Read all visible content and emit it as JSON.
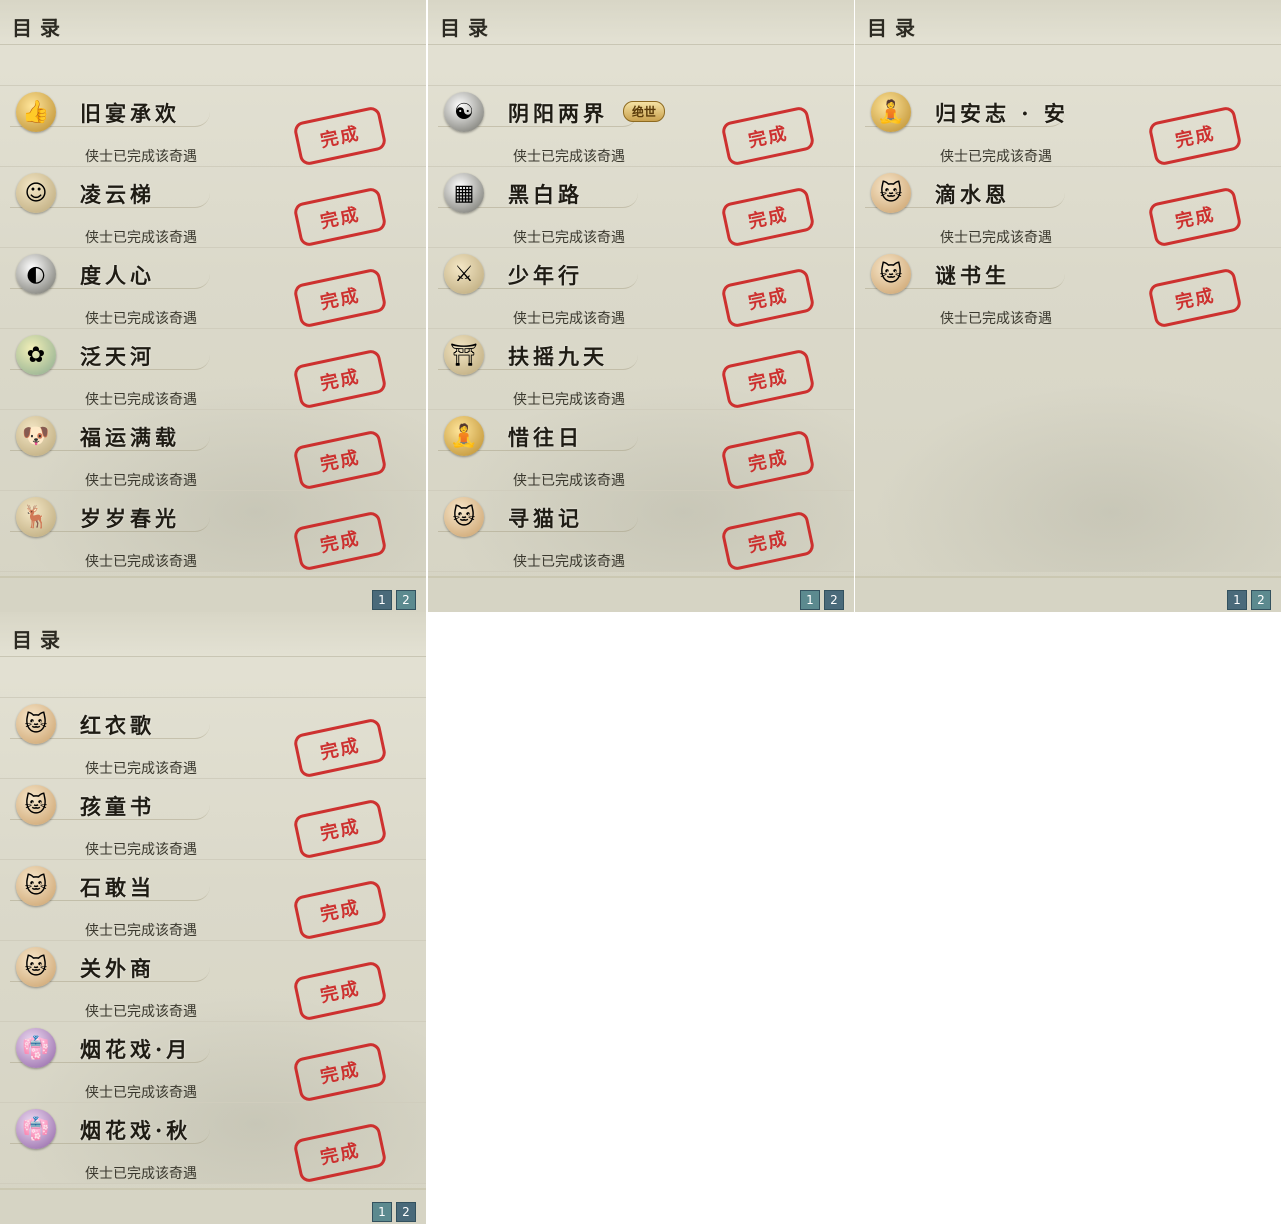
{
  "panels": [
    {
      "title": "目录",
      "rows": [
        {
          "name": "旧宴承欢",
          "icon": "thumb-icon",
          "glyph": "👍",
          "status": "侠士已完成该奇遇",
          "seal": "完成"
        },
        {
          "name": "凌云梯",
          "icon": "face-icon",
          "glyph": "☺",
          "status": "侠士已完成该奇遇",
          "seal": "完成"
        },
        {
          "name": "度人心",
          "icon": "mask-icon",
          "glyph": "◐",
          "status": "侠士已完成该奇遇",
          "seal": "完成"
        },
        {
          "name": "泛天河",
          "icon": "butterfly-icon",
          "glyph": "✿",
          "status": "侠士已完成该奇遇",
          "seal": "完成"
        },
        {
          "name": "福运满载",
          "icon": "dog-icon",
          "glyph": "🐶",
          "status": "侠士已完成该奇遇",
          "seal": "完成"
        },
        {
          "name": "岁岁春光",
          "icon": "deer-icon",
          "glyph": "🦌",
          "status": "侠士已完成该奇遇",
          "seal": "完成"
        }
      ],
      "pages": [
        "1",
        "2"
      ],
      "active_page": "2"
    },
    {
      "title": "目录",
      "rows": [
        {
          "name": "阴阳两界",
          "icon": "yin-yang-icon",
          "glyph": "☯",
          "status": "侠士已完成该奇遇",
          "seal": "完成",
          "badge": "绝世"
        },
        {
          "name": "黑白路",
          "icon": "go-board-icon",
          "glyph": "▦",
          "status": "侠士已完成该奇遇",
          "seal": "完成"
        },
        {
          "name": "少年行",
          "icon": "swordsman-icon",
          "glyph": "⚔",
          "status": "侠士已完成该奇遇",
          "seal": "完成"
        },
        {
          "name": "扶摇九天",
          "icon": "pillar-icon",
          "glyph": "⛩",
          "status": "侠士已完成该奇遇",
          "seal": "完成"
        },
        {
          "name": "惜往日",
          "icon": "gold-figure-icon",
          "glyph": "🧘",
          "status": "侠士已完成该奇遇",
          "seal": "完成"
        },
        {
          "name": "寻猫记",
          "icon": "cat-icon",
          "glyph": "🐱",
          "status": "侠士已完成该奇遇",
          "seal": "完成"
        }
      ],
      "pages": [
        "1",
        "2"
      ],
      "active_page": "1"
    },
    {
      "title": "目录",
      "rows": [
        {
          "name": "归安志 · 安",
          "icon": "gold-figure-icon",
          "glyph": "🧘",
          "status": "侠士已完成该奇遇",
          "seal": "完成"
        },
        {
          "name": "滴水恩",
          "icon": "cat-icon",
          "glyph": "🐱",
          "status": "侠士已完成该奇遇",
          "seal": "完成"
        },
        {
          "name": "谜书生",
          "icon": "cat-icon",
          "glyph": "🐱",
          "status": "侠士已完成该奇遇",
          "seal": "完成"
        }
      ],
      "pages": [
        "1",
        "2"
      ],
      "active_page": "2"
    },
    {
      "title": "目录",
      "rows": [
        {
          "name": "红衣歌",
          "icon": "cat-icon",
          "glyph": "🐱",
          "status": "侠士已完成该奇遇",
          "seal": "完成"
        },
        {
          "name": "孩童书",
          "icon": "cat-icon",
          "glyph": "🐱",
          "status": "侠士已完成该奇遇",
          "seal": "完成"
        },
        {
          "name": "石敢当",
          "icon": "cat-icon",
          "glyph": "🐱",
          "status": "侠士已完成该奇遇",
          "seal": "完成"
        },
        {
          "name": "关外商",
          "icon": "cat-icon",
          "glyph": "🐱",
          "status": "侠士已完成该奇遇",
          "seal": "完成"
        },
        {
          "name": "烟花戏·月",
          "icon": "lady-icon",
          "glyph": "👘",
          "status": "侠士已完成该奇遇",
          "seal": "完成"
        },
        {
          "name": "烟花戏·秋",
          "icon": "lady-icon",
          "glyph": "👘",
          "status": "侠士已完成该奇遇",
          "seal": "完成"
        }
      ],
      "pages": [
        "1",
        "2"
      ],
      "active_page": "1"
    }
  ]
}
